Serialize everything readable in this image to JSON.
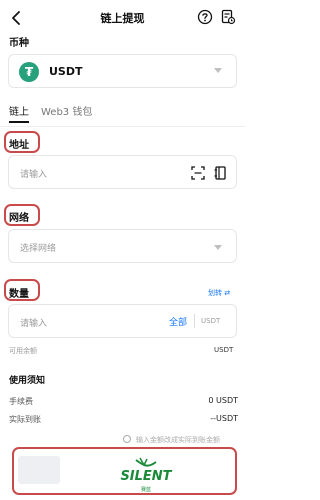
{
  "header": {
    "title": "链上提现",
    "back_icon": "chevron-left-icon",
    "help_icon": "help-circle-icon",
    "record_icon": "records-icon"
  },
  "coin_section": {
    "label": "币种",
    "selected_coin": "USDT",
    "coin_symbol": "₮",
    "coin_color": "#26a17b"
  },
  "tabs": [
    {
      "label": "链上",
      "active": true
    },
    {
      "label": "Web3 钱包",
      "active": false
    }
  ],
  "address_section": {
    "label": "地址",
    "placeholder": "请输入",
    "scan_icon": "scan-icon",
    "addressbook_icon": "address-book-icon"
  },
  "network_section": {
    "label": "网络",
    "placeholder": "选择网络"
  },
  "amount_section": {
    "label": "数量",
    "transfer_link": "划转 ⇄",
    "placeholder": "请输入",
    "all_button": "全部",
    "unit": "USDT",
    "available_label": "可用余额",
    "available_value": "USDT"
  },
  "notice_section": {
    "title": "使用须知",
    "fee_label": "手续费",
    "fee_value": "0 USDT",
    "received_label": "实际到账",
    "received_value": "--USDT",
    "toggle_hint": "输入金额改成实际到账金额"
  },
  "watermark": {
    "text": "SILENT",
    "sub": "赛蓝"
  },
  "colors": {
    "accent": "#1677ff",
    "outline": "#c84a4a",
    "brand_green": "#1a8a3a"
  }
}
